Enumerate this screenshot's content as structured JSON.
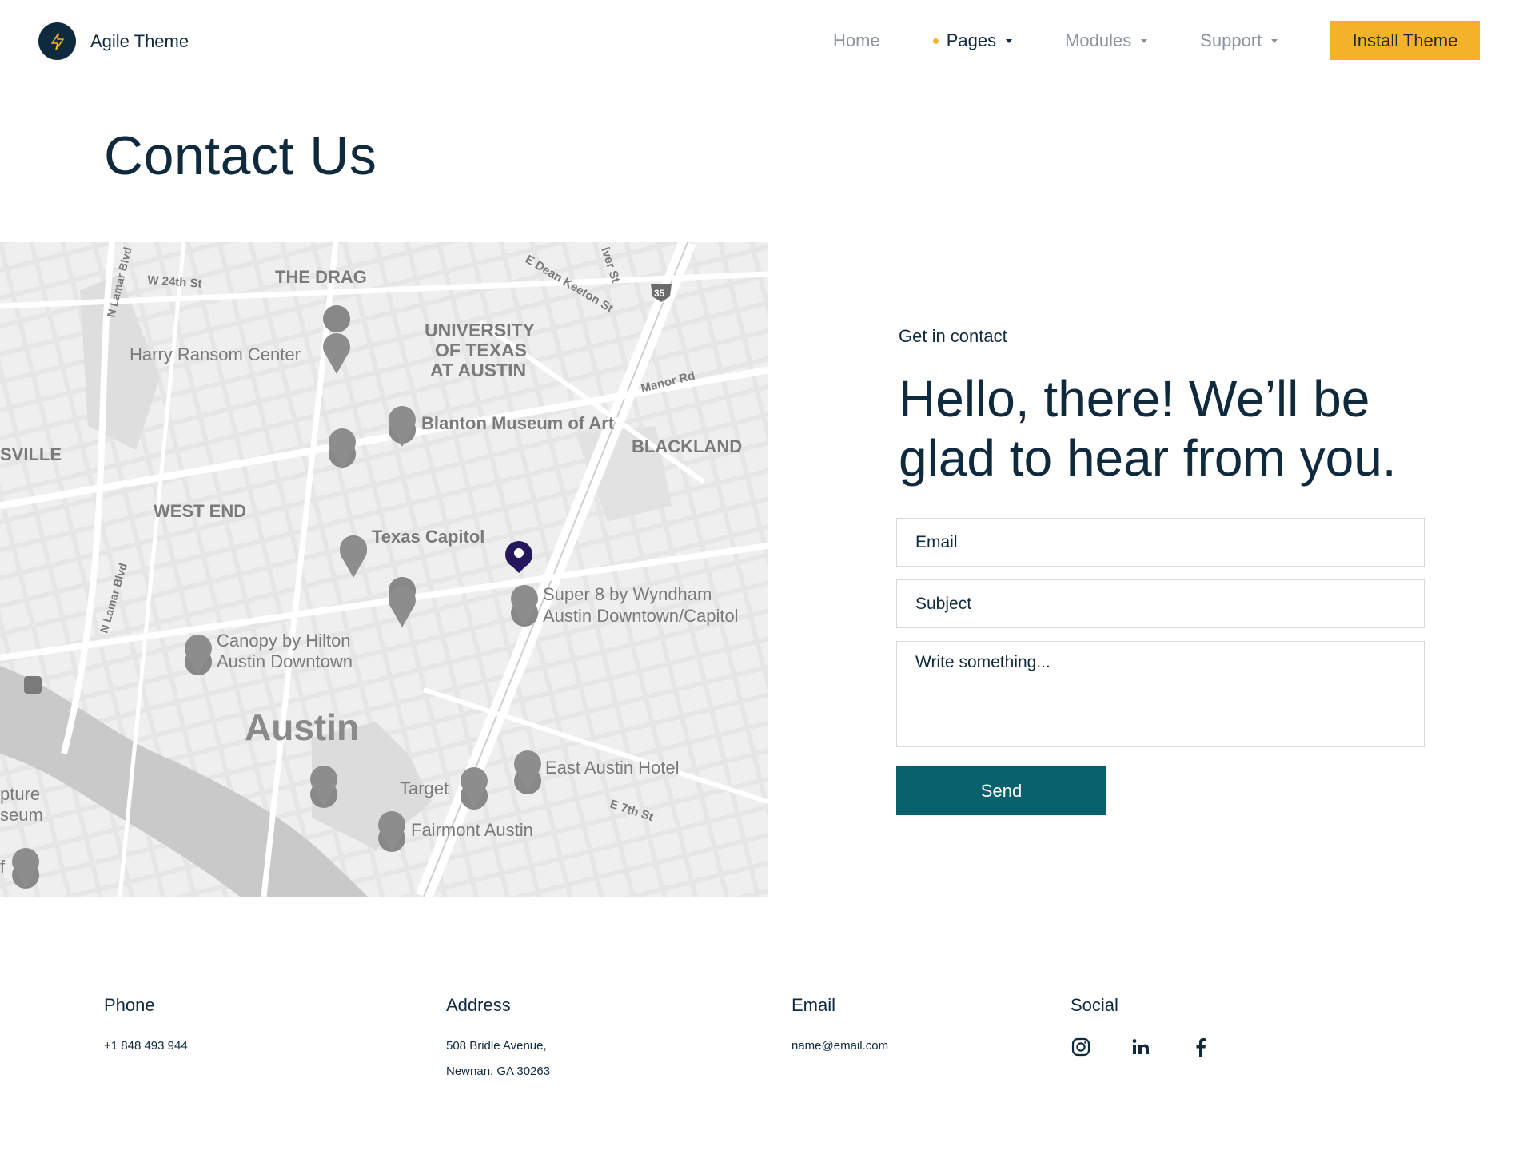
{
  "header": {
    "brand": "Agile Theme",
    "nav": [
      {
        "label": "Home"
      },
      {
        "label": "Pages"
      },
      {
        "label": "Modules"
      },
      {
        "label": "Support"
      }
    ],
    "cta": "Install Theme"
  },
  "page": {
    "title": "Contact Us"
  },
  "map": {
    "labels": {
      "the_drag": "THE DRAG",
      "w24th": "W 24th St",
      "nlamar_top": "N Lamar Blvd",
      "nlamar_mid": "N Lamar Blvd",
      "edean": "E Dean Keeton St",
      "river": "iver St",
      "i35": "35",
      "ut1": "UNIVERSITY",
      "ut2": "OF TEXAS",
      "ut3": "AT AUSTIN",
      "harry": "Harry Ransom Center",
      "manor": "Manor Rd",
      "blanton": "Blanton Museum of Art",
      "blackland": "BLACKLAND",
      "sville": "SVILLE",
      "west_end": "WEST END",
      "capitol": "Texas Capitol",
      "super8_1": "Super 8 by Wyndham",
      "super8_2": "Austin Downtown/Capitol",
      "canopy1": "Canopy by Hilton",
      "canopy2": "Austin Downtown",
      "austin": "Austin",
      "east_austin": "East Austin Hotel",
      "target": "Target",
      "e7th": "E 7th St",
      "fairmont": "Fairmont Austin",
      "pture": "pture",
      "seum": "seum",
      "f": "f"
    }
  },
  "contact": {
    "eyebrow": "Get in contact",
    "headline": "Hello, there! We’ll be glad to hear from you.",
    "email_placeholder": "Email",
    "subject_placeholder": "Subject",
    "message_placeholder": "Write something...",
    "send": "Send"
  },
  "info": {
    "phone_label": "Phone",
    "phone": "+1 848 493 944",
    "address_label": "Address",
    "address_line1": "508 Bridle Avenue,",
    "address_line2": "Newnan, GA 30263",
    "email_label": "Email",
    "email": "name@email.com",
    "social_label": "Social",
    "social": [
      "instagram-icon",
      "linkedin-icon",
      "facebook-icon"
    ]
  },
  "colors": {
    "primary": "#0f2a3d",
    "accent": "#f4b22b",
    "button": "#07606b",
    "map_bg": "#ebebeb"
  }
}
